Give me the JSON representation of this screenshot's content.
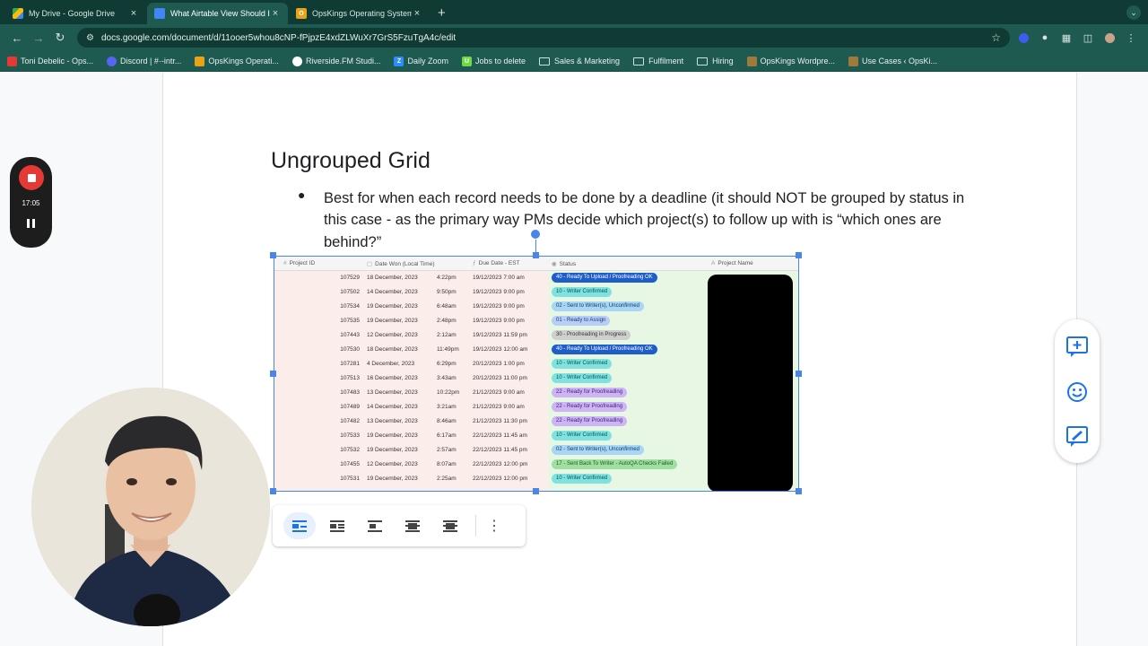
{
  "browser": {
    "tabs": [
      {
        "title": "My Drive - Google Drive",
        "icon": "google-drive-icon",
        "active": false
      },
      {
        "title": "What Airtable View Should I Use",
        "icon": "google-docs-icon",
        "active": true
      },
      {
        "title": "OpsKings Operating System",
        "icon": "opskings-icon",
        "active": false
      }
    ],
    "new_tab": "+",
    "close_glyph": "×",
    "url": "docs.google.com/document/d/11ooer5whou8cNP-fPjpzE4xdZLWuXr7GrS5FzuTgA4c/edit",
    "bookmarks": [
      {
        "label": "Toni Debelic - Ops...",
        "icon": "app-icon"
      },
      {
        "label": "Discord | #·-intr...",
        "icon": "discord-icon"
      },
      {
        "label": "OpsKings Operati...",
        "icon": "opskings-icon"
      },
      {
        "label": "Riverside.FM Studi...",
        "icon": "riverside-icon"
      },
      {
        "label": "Daily Zoom",
        "icon": "zoom-icon"
      },
      {
        "label": "Jobs to delete",
        "icon": "upwork-icon"
      },
      {
        "label": "Sales & Marketing",
        "icon": "folder-icon"
      },
      {
        "label": "Fulfilment",
        "icon": "folder-icon"
      },
      {
        "label": "Hiring",
        "icon": "folder-icon"
      },
      {
        "label": "OpsKings Wordpre...",
        "icon": "wordpress-icon"
      },
      {
        "label": "Use Cases ‹ OpsKi...",
        "icon": "wordpress-icon"
      }
    ]
  },
  "document": {
    "heading": "Ungrouped Grid",
    "bullet_glyph": "●",
    "bullet": "Best for when each record needs to be done by a deadline (it should NOT be grouped by status in this case - as the primary way PMs decide which project(s) to follow up with is “which ones are behind?”"
  },
  "grid": {
    "columns": [
      "Project ID",
      "Date Won (Local Time)",
      "Due Date - EST",
      "Status",
      "Project Name"
    ],
    "rows": [
      {
        "id": "107529",
        "date": "18 December, 2023",
        "time": "4:22pm",
        "due": "19/12/2023 7:00 am",
        "status": "40 - Ready To Upload / Proofreading OK",
        "kind": "upload"
      },
      {
        "id": "107502",
        "date": "14 December, 2023",
        "time": "9:50pm",
        "due": "19/12/2023 9:00 pm",
        "status": "10 - Writer Confirmed",
        "kind": "confirmed"
      },
      {
        "id": "107534",
        "date": "19 December, 2023",
        "time": "6:48am",
        "due": "19/12/2023 9:00 pm",
        "status": "02 - Sent to Writer(s), Unconfirmed",
        "kind": "sent"
      },
      {
        "id": "107535",
        "date": "19 December, 2023",
        "time": "2:48pm",
        "due": "19/12/2023 9:00 pm",
        "status": "01 - Ready to Assign",
        "kind": "assign"
      },
      {
        "id": "107443",
        "date": "12 December, 2023",
        "time": "2:12am",
        "due": "19/12/2023 11:59 pm",
        "status": "30 - Proofreading in Progress",
        "kind": "proof"
      },
      {
        "id": "107530",
        "date": "18 December, 2023",
        "time": "11:49pm",
        "due": "19/12/2023 12:00 am",
        "status": "40 - Ready To Upload / Proofreading OK",
        "kind": "upload"
      },
      {
        "id": "107281",
        "date": "4 December, 2023",
        "time": "6:29pm",
        "due": "20/12/2023 1:00 pm",
        "status": "10 - Writer Confirmed",
        "kind": "confirmed"
      },
      {
        "id": "107513",
        "date": "16 December, 2023",
        "time": "3:43am",
        "due": "20/12/2023 11:00 pm",
        "status": "10 - Writer Confirmed",
        "kind": "confirmed"
      },
      {
        "id": "107483",
        "date": "13 December, 2023",
        "time": "10:22pm",
        "due": "21/12/2023 9:00 am",
        "status": "22 - Ready for Proofreading",
        "kind": "ready"
      },
      {
        "id": "107489",
        "date": "14 December, 2023",
        "time": "3:21am",
        "due": "21/12/2023 9:00 am",
        "status": "22 - Ready for Proofreading",
        "kind": "ready"
      },
      {
        "id": "107482",
        "date": "13 December, 2023",
        "time": "8:46am",
        "due": "21/12/2023 11:30 pm",
        "status": "22 - Ready for Proofreading",
        "kind": "ready"
      },
      {
        "id": "107533",
        "date": "19 December, 2023",
        "time": "6:17am",
        "due": "22/12/2023 11:45 am",
        "status": "10 - Writer Confirmed",
        "kind": "confirmed"
      },
      {
        "id": "107532",
        "date": "19 December, 2023",
        "time": "2:57am",
        "due": "22/12/2023 11:45 pm",
        "status": "02 - Sent to Writer(s), Unconfirmed",
        "kind": "sent"
      },
      {
        "id": "107455",
        "date": "12 December, 2023",
        "time": "8:07am",
        "due": "22/12/2023 12:00 pm",
        "status": "17 - Sent Back To Writer - AutoQA Checks Failed",
        "kind": "sentback"
      },
      {
        "id": "107531",
        "date": "19 December, 2023",
        "time": "2:25am",
        "due": "22/12/2023 12:00 pm",
        "status": "10 - Writer Confirmed",
        "kind": "confirmed"
      }
    ],
    "status_colors": {
      "upload": {
        "bg": "#1f5ec9",
        "fg": "#ffffff"
      },
      "confirmed": {
        "bg": "#7ee3e0",
        "fg": "#0b4f4c"
      },
      "sent": {
        "bg": "#a9d6f5",
        "fg": "#0d3b66"
      },
      "assign": {
        "bg": "#b7cff7",
        "fg": "#1a3a7a"
      },
      "proof": {
        "bg": "#cfcfcf",
        "fg": "#333333"
      },
      "ready": {
        "bg": "#cdb4f5",
        "fg": "#3d1f7a"
      },
      "sentback": {
        "bg": "#9fe0a0",
        "fg": "#1d5a1f"
      }
    }
  },
  "recorder": {
    "time": "17:05"
  }
}
